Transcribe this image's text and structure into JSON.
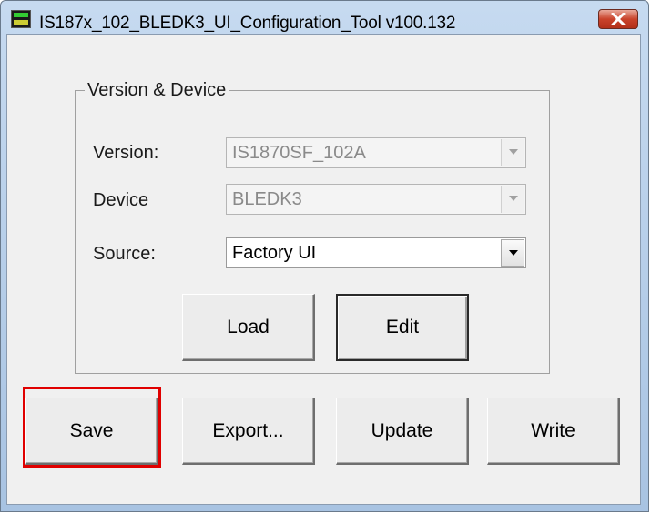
{
  "window": {
    "title": "IS187x_102_BLEDK3_UI_Configuration_Tool v100.132"
  },
  "group": {
    "title": "Version & Device"
  },
  "fields": {
    "version": {
      "label": "Version:",
      "value": "IS1870SF_102A",
      "enabled": false
    },
    "device": {
      "label": "Device",
      "value": "BLEDK3",
      "enabled": false
    },
    "source": {
      "label": "Source:",
      "value": "Factory UI",
      "enabled": true
    }
  },
  "buttons": {
    "load": "Load",
    "edit": "Edit",
    "save": "Save",
    "export": "Export...",
    "update": "Update",
    "write": "Write"
  },
  "highlight": {
    "target": "save",
    "color": "#e00000"
  },
  "icons": {
    "app": "app-icon",
    "close": "close-icon",
    "dropdown": "chevron-down-icon"
  }
}
